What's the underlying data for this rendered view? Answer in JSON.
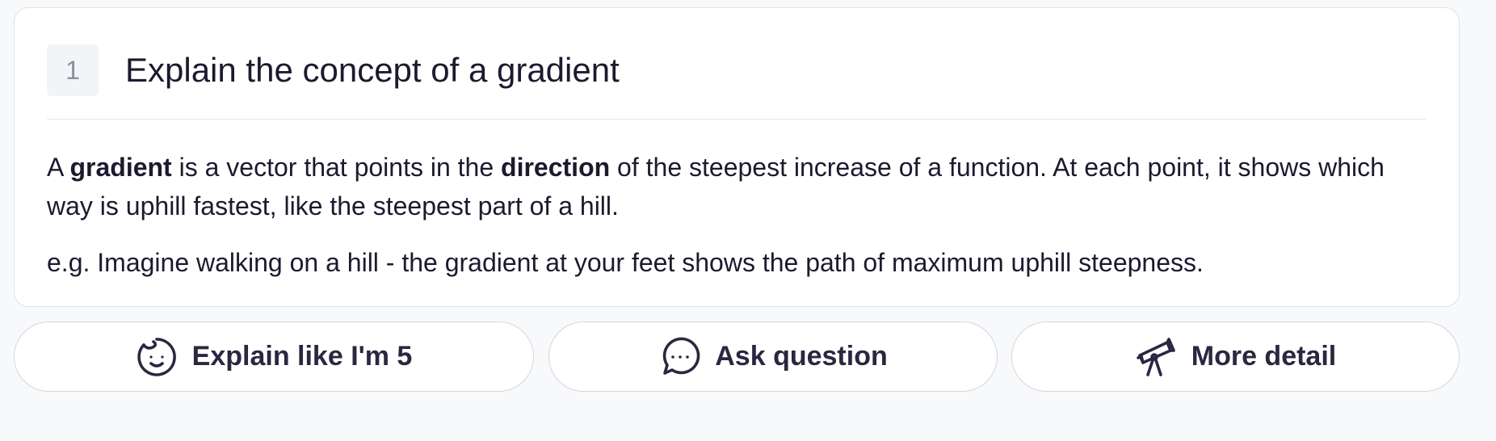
{
  "card": {
    "step_number": "1",
    "title": "Explain the concept of a gradient",
    "body": {
      "part1": "A ",
      "term1": "gradient",
      "part2": " is a vector that points in the ",
      "term2": "direction",
      "part3": " of the steepest increase of a function. At each point, it shows which way is uphill fastest, like the steepest part of a hill."
    },
    "example": "e.g. Imagine walking on a hill - the gradient at your feet shows the path of maximum uphill steepness."
  },
  "actions": [
    {
      "label": "Explain like I'm 5",
      "icon": "baby-face-icon"
    },
    {
      "label": "Ask question",
      "icon": "chat-bubble-icon"
    },
    {
      "label": "More detail",
      "icon": "telescope-icon"
    }
  ],
  "colors": {
    "background": "#f8f9fb",
    "card": "#ffffff",
    "text": "#1b1a2e",
    "border": "#dfe2e8",
    "badge_bg": "#f3f4f7",
    "badge_text": "#8d8e98"
  }
}
